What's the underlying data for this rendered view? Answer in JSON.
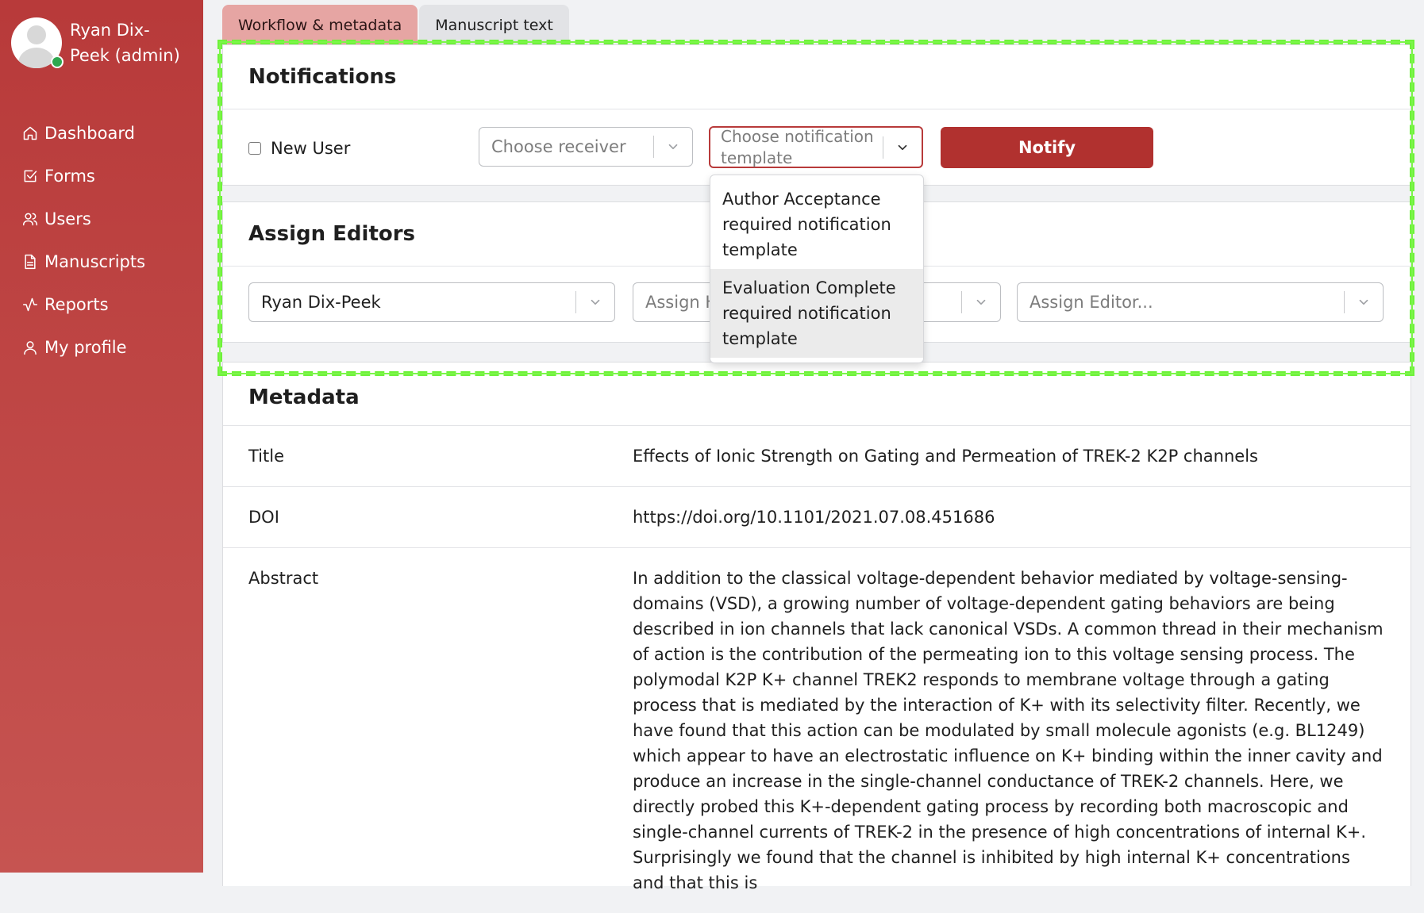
{
  "user": {
    "name": "Ryan Dix-Peek (admin)",
    "online_color": "#2fa84f"
  },
  "nav": [
    {
      "label": "Dashboard",
      "icon": "home-icon"
    },
    {
      "label": "Forms",
      "icon": "check-square-icon"
    },
    {
      "label": "Users",
      "icon": "users-icon"
    },
    {
      "label": "Manuscripts",
      "icon": "file-text-icon"
    },
    {
      "label": "Reports",
      "icon": "activity-icon"
    },
    {
      "label": "My profile",
      "icon": "user-icon"
    }
  ],
  "tabs": [
    {
      "label": "Workflow & metadata",
      "active": true
    },
    {
      "label": "Manuscript text",
      "active": false
    }
  ],
  "notifications": {
    "title": "Notifications",
    "new_user_label": "New User",
    "new_user_checked": false,
    "receiver_placeholder": "Choose receiver",
    "template_placeholder": "Choose notification template",
    "notify_label": "Notify",
    "template_options": [
      "Author Acceptance required notification template",
      "Evaluation Complete required notification template"
    ]
  },
  "assign_editors": {
    "title": "Assign Editors",
    "editor_1": "Ryan Dix-Peek",
    "editor_2_placeholder": "Assign H",
    "editor_3_placeholder": "",
    "editor_4_placeholder": "Assign Editor..."
  },
  "metadata": {
    "title": "Metadata",
    "rows": [
      {
        "label": "Title",
        "value": "Effects of Ionic Strength on Gating and Permeation of TREK-2 K2P channels"
      },
      {
        "label": "DOI",
        "value": "https://doi.org/10.1101/2021.07.08.451686"
      },
      {
        "label": "Abstract",
        "value": "In addition to the classical voltage-dependent behavior mediated by voltage-sensing-domains (VSD), a growing number of voltage-dependent gating behaviors are being described in ion channels that lack canonical VSDs. A common thread in their mechanism of action is the contribution of the permeating ion to this voltage sensing process. The polymodal K2P K+ channel TREK2 responds to membrane voltage through a gating process that is mediated by the interaction of K+ with its selectivity filter. Recently, we have found that this action can be modulated by small molecule agonists (e.g. BL1249) which appear to have an electrostatic influence on K+ binding within the inner cavity and produce an increase in the single-channel conductance of TREK-2 channels. Here, we directly probed this K+-dependent gating process by recording both macroscopic and single-channel currents of TREK-2 in the presence of high concentrations of internal K+. Surprisingly we found that the channel is inhibited by high internal K+ concentrations and that this is"
      }
    ]
  },
  "colors": {
    "sidebar": "#b83a3a",
    "accent": "#b1312f",
    "highlight": "#6ef23a"
  }
}
